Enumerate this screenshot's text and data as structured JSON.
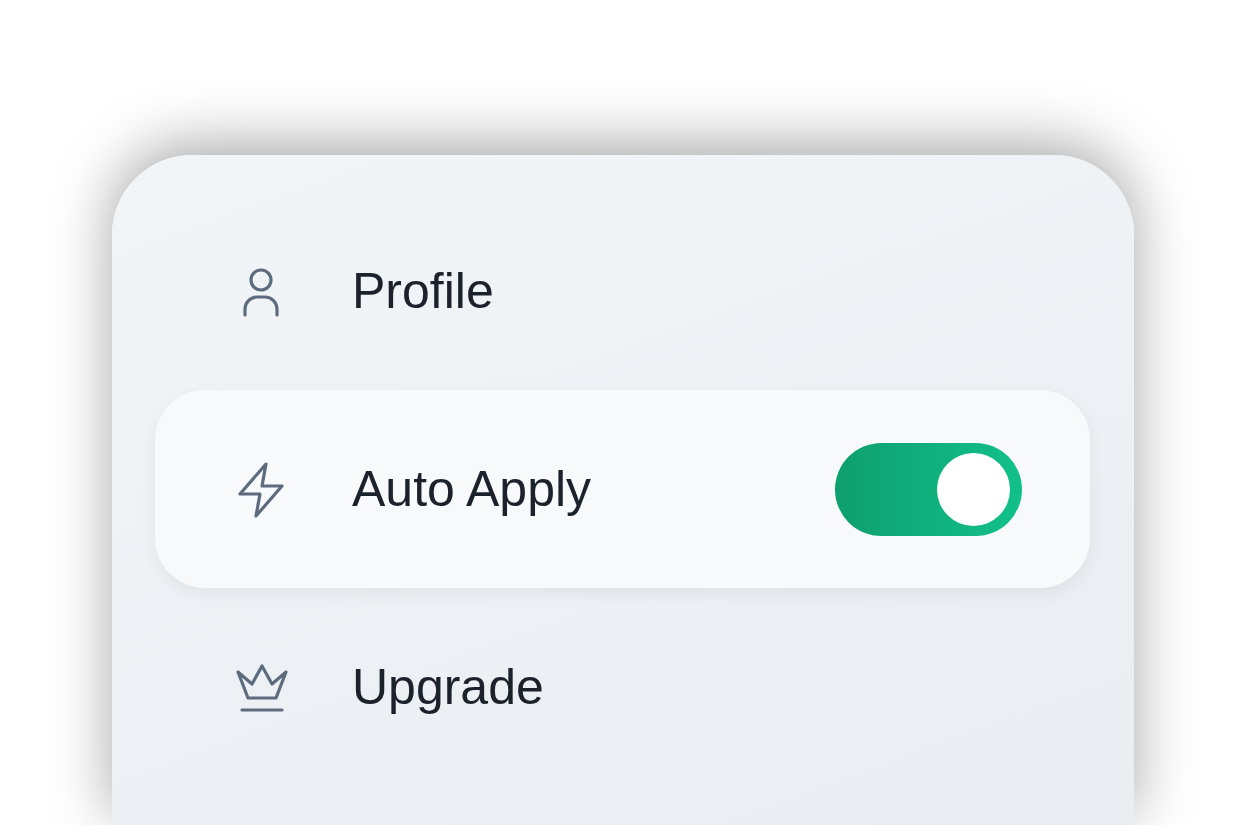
{
  "menu": [
    {
      "kind": "link",
      "label": "Profile",
      "selected": false
    },
    {
      "kind": "toggle",
      "label": "Auto Apply",
      "selected": true,
      "on": true
    },
    {
      "kind": "link",
      "label": "Upgrade",
      "selected": false
    }
  ]
}
